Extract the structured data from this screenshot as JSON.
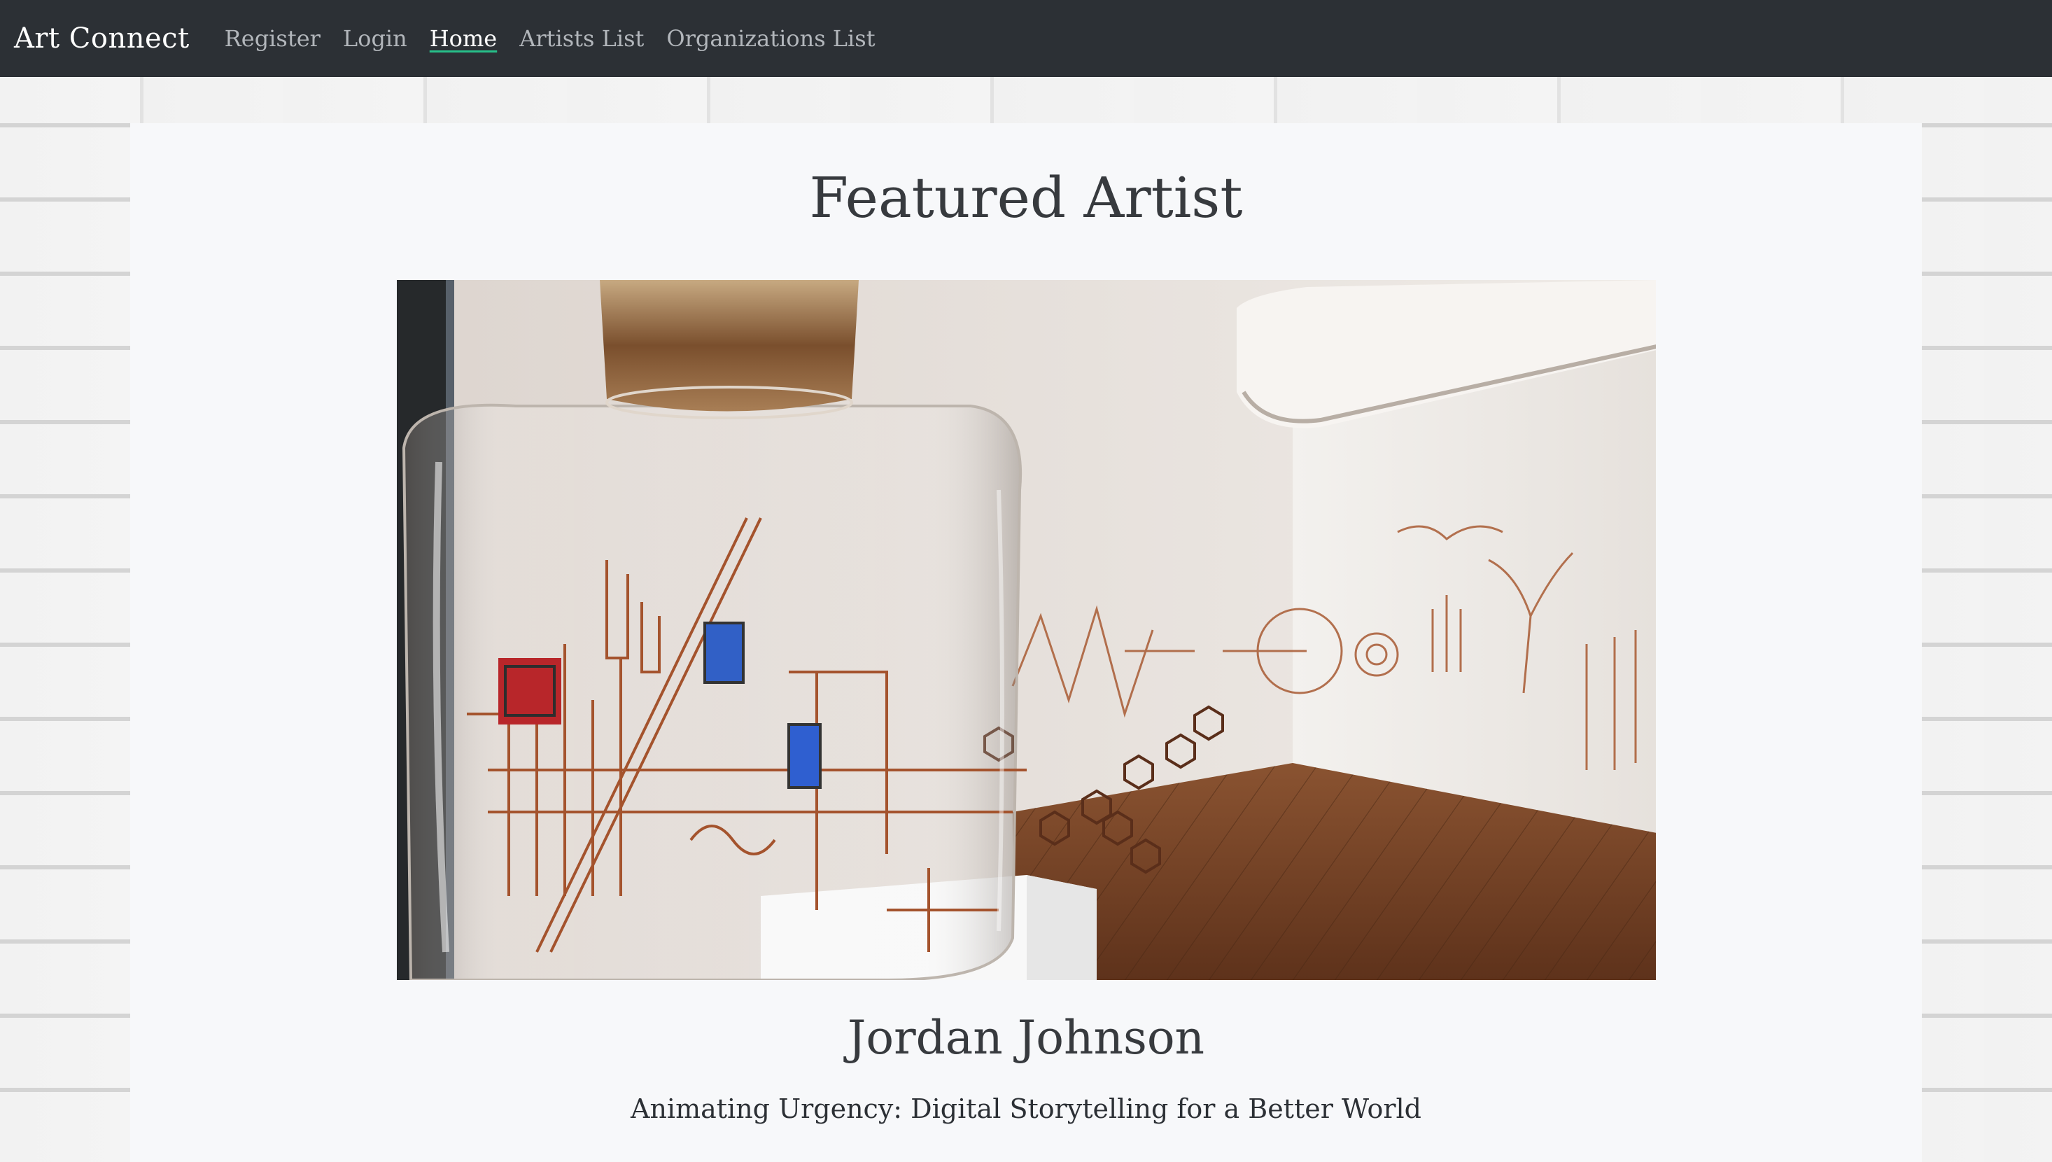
{
  "navbar": {
    "brand": "Art Connect",
    "links": [
      {
        "label": "Register",
        "active": false
      },
      {
        "label": "Login",
        "active": false
      },
      {
        "label": "Home",
        "active": true
      },
      {
        "label": "Artists List",
        "active": false
      },
      {
        "label": "Organizations List",
        "active": false
      }
    ]
  },
  "featured": {
    "title": "Featured Artist",
    "artist_name": "Jordan Johnson",
    "tagline": "Animating Urgency: Digital Storytelling for a Better World"
  },
  "colors": {
    "navbar_bg": "#2c3035",
    "active_underline": "#27c08a",
    "card_bg": "#f7f8fa"
  }
}
